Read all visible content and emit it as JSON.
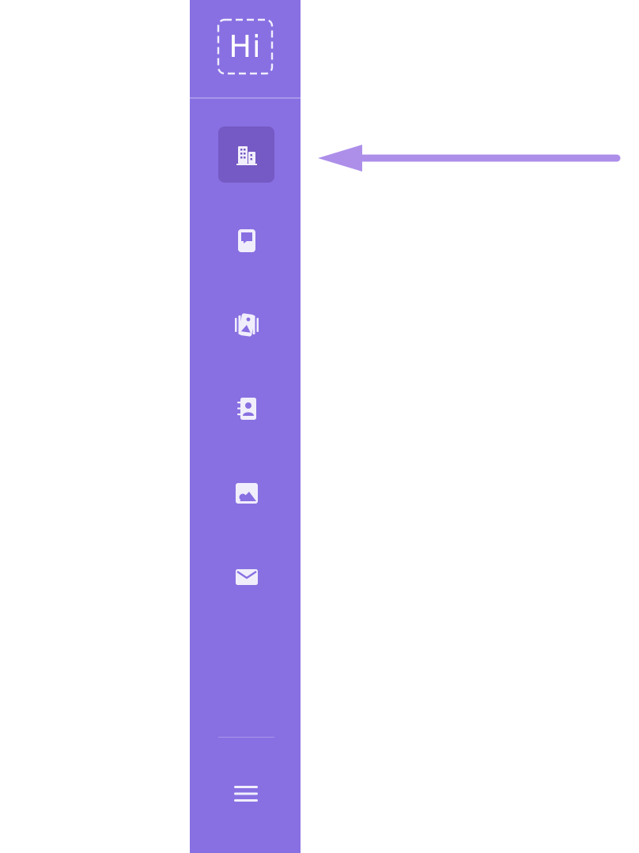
{
  "app": {
    "logo_text": "Hi"
  },
  "colors": {
    "sidebar_bg": "#8870e2",
    "active_item_bg": "#7559c4",
    "icon": "#f1eefc",
    "arrow": "#ad8fea"
  },
  "sidebar": {
    "items": [
      {
        "icon": "building-icon",
        "active": true
      },
      {
        "icon": "chat-tablet-icon",
        "active": false
      },
      {
        "icon": "image-gallery-icon",
        "active": false
      },
      {
        "icon": "contact-book-icon",
        "active": false
      },
      {
        "icon": "image-icon",
        "active": false
      },
      {
        "icon": "envelope-icon",
        "active": false
      }
    ],
    "footer": {
      "icon": "hamburger-menu-icon"
    }
  },
  "annotation": {
    "icon": "left-arrow-icon",
    "points_to": "building-icon"
  }
}
